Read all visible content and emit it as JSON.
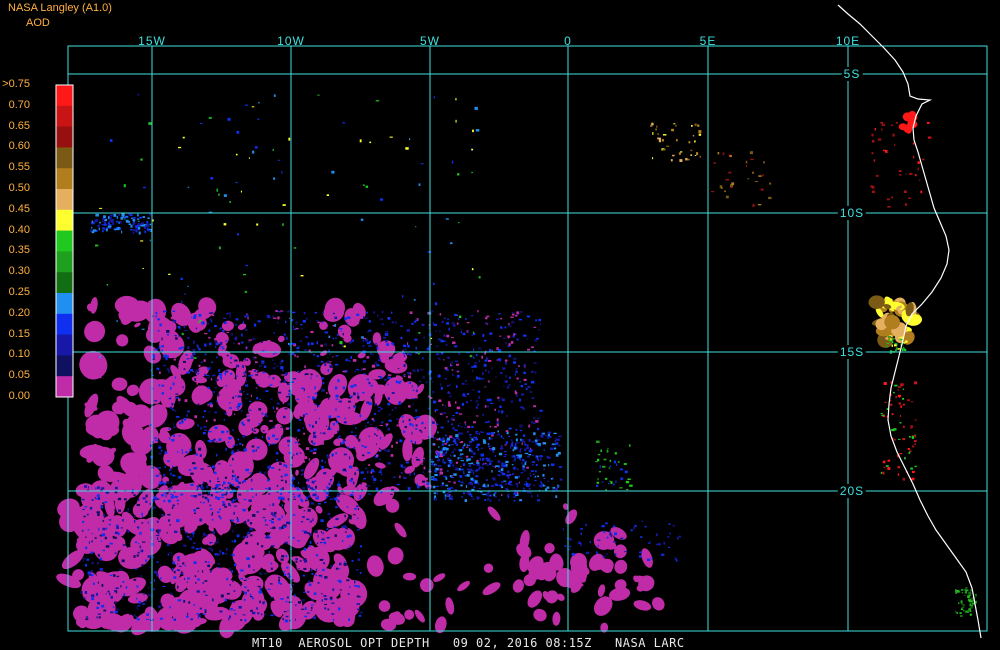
{
  "header": {
    "title": "NASA Langley (A1.0)",
    "subtitle": "AOD"
  },
  "legend": {
    "labels": [
      ">0.75",
      "0.70",
      "0.65",
      "0.60",
      "0.55",
      "0.50",
      "0.45",
      "0.40",
      "0.35",
      "0.30",
      "0.25",
      "0.20",
      "0.15",
      "0.10",
      "0.05",
      "0.00"
    ],
    "colors": [
      "#ff1818",
      "#c81414",
      "#961010",
      "#7a5a14",
      "#b07e1c",
      "#e4b060",
      "#ffff30",
      "#20c820",
      "#1ea01e",
      "#126e12",
      "#2090f0",
      "#1030f0",
      "#1818a8",
      "#101060",
      "#c02ca8"
    ]
  },
  "map": {
    "lon_labels": [
      "15W",
      "10W",
      "5W",
      "0",
      "5E",
      "10E"
    ],
    "lat_labels": [
      "5S",
      "10S",
      "15S",
      "20S"
    ],
    "grid_color": "#40e0e0",
    "coast_color": "#ffffff"
  },
  "footer": {
    "text": "MT10  AEROSOL OPT DEPTH   09 02, 2016 08:15Z   NASA LARC"
  }
}
